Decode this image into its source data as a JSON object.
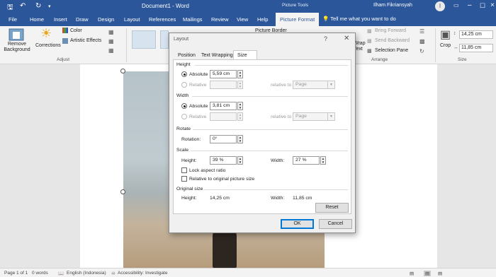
{
  "titlebar": {
    "doc_title": "Document1 - Word",
    "context_tools": "Picture Tools",
    "user": "Ilham Fikriansyah",
    "avatar_initial": "I",
    "icons": {
      "save": "save-icon",
      "undo": "undo-icon",
      "redo": "redo-icon",
      "customize": "chevron-down-icon"
    }
  },
  "tabs": [
    "File",
    "Home",
    "Insert",
    "Draw",
    "Design",
    "Layout",
    "References",
    "Mailings",
    "Review",
    "View",
    "Help",
    "Picture Format"
  ],
  "tell_me": "Tell me what you want to do",
  "ribbon": {
    "remove_bg": "Remove Background",
    "corrections": "Corrections",
    "color": "Color",
    "artistic": "Artistic Effects",
    "adjust_group": "Adjust",
    "picture_border": "Picture Border",
    "wrap_text": "Wrap Text",
    "bring_forward": "Bring Forward",
    "send_backward": "Send Backward",
    "selection_pane": "Selection Pane",
    "arrange_group": "Arrange",
    "crop": "Crop",
    "height_value": "14,25 cm",
    "width_value": "11,85 cm",
    "size_group": "Size"
  },
  "status": {
    "page": "Page 1 of 1",
    "words": "0 words",
    "language": "English (Indonesia)",
    "accessibility": "Accessibility: Investigate"
  },
  "dialog": {
    "title": "Layout",
    "help": "?",
    "close": "✕",
    "tabs": [
      "Position",
      "Text Wrapping",
      "Size"
    ],
    "height_section": "Height",
    "width_section": "Width",
    "absolute": "Absolute",
    "relative": "Relative",
    "relative_to": "relative to",
    "page_option": "Page",
    "height_absolute": "5,59 cm",
    "width_absolute": "3,81 cm",
    "rotate_section": "Rotate",
    "rotation_label": "Rotation:",
    "rotation_value": "0°",
    "scale_section": "Scale",
    "scale_height_label": "Height:",
    "scale_height_value": "39 %",
    "scale_width_label": "Width:",
    "scale_width_value": "27 %",
    "lock_aspect": "Lock aspect ratio",
    "relative_original": "Relative to original picture size",
    "original_section": "Original size",
    "orig_height_label": "Height:",
    "orig_height_value": "14,25 cm",
    "orig_width_label": "Width:",
    "orig_width_value": "11,85 cm",
    "reset": "Reset",
    "ok": "OK",
    "cancel": "Cancel"
  }
}
